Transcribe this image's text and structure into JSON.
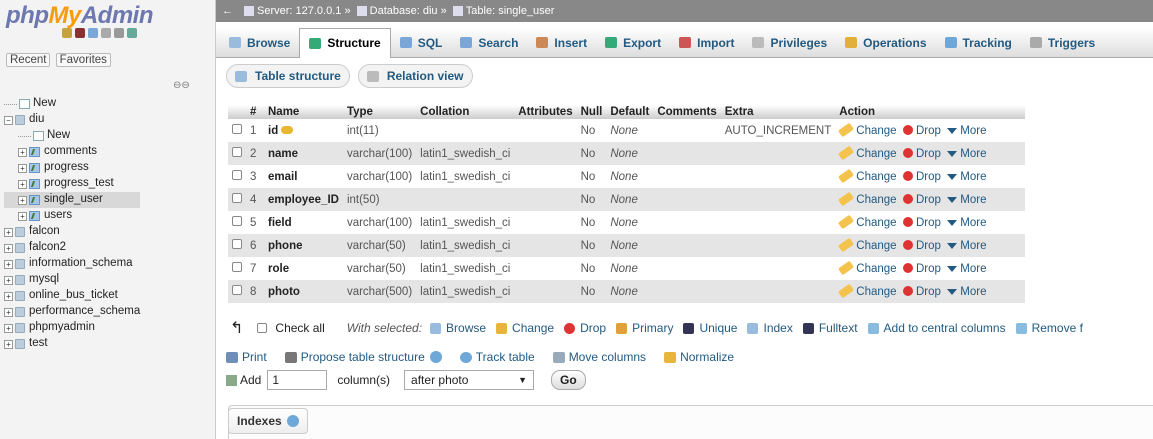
{
  "logo": {
    "php": "php",
    "my": "My",
    "admin": "Admin"
  },
  "left_tabs": [
    "Recent",
    "Favorites"
  ],
  "tree": [
    {
      "label": "New",
      "level": 0,
      "type": "new"
    },
    {
      "label": "diu",
      "level": 0,
      "type": "db",
      "expanded": true
    },
    {
      "label": "New",
      "level": 1,
      "type": "new"
    },
    {
      "label": "comments",
      "level": 1,
      "type": "table"
    },
    {
      "label": "progress",
      "level": 1,
      "type": "table"
    },
    {
      "label": "progress_test",
      "level": 1,
      "type": "table"
    },
    {
      "label": "single_user",
      "level": 1,
      "type": "table",
      "selected": true
    },
    {
      "label": "users",
      "level": 1,
      "type": "table"
    },
    {
      "label": "falcon",
      "level": 0,
      "type": "db"
    },
    {
      "label": "falcon2",
      "level": 0,
      "type": "db"
    },
    {
      "label": "information_schema",
      "level": 0,
      "type": "db"
    },
    {
      "label": "mysql",
      "level": 0,
      "type": "db"
    },
    {
      "label": "online_bus_ticket",
      "level": 0,
      "type": "db"
    },
    {
      "label": "performance_schema",
      "level": 0,
      "type": "db"
    },
    {
      "label": "phpmyadmin",
      "level": 0,
      "type": "db"
    },
    {
      "label": "test",
      "level": 0,
      "type": "db"
    }
  ],
  "breadcrumb": {
    "server": "Server: 127.0.0.1",
    "sep": "»",
    "database": "Database: diu",
    "table": "Table: single_user"
  },
  "tabs": [
    "Browse",
    "Structure",
    "SQL",
    "Search",
    "Insert",
    "Export",
    "Import",
    "Privileges",
    "Operations",
    "Tracking",
    "Triggers"
  ],
  "active_tab": "Structure",
  "subtabs": [
    "Table structure",
    "Relation view"
  ],
  "columns": [
    "#",
    "Name",
    "Type",
    "Collation",
    "Attributes",
    "Null",
    "Default",
    "Comments",
    "Extra",
    "Action"
  ],
  "rows": [
    {
      "n": "1",
      "name": "id",
      "type": "int(11)",
      "collation": "",
      "null": "No",
      "default": "None",
      "extra": "AUTO_INCREMENT",
      "key": true
    },
    {
      "n": "2",
      "name": "name",
      "type": "varchar(100)",
      "collation": "latin1_swedish_ci",
      "null": "No",
      "default": "None",
      "extra": ""
    },
    {
      "n": "3",
      "name": "email",
      "type": "varchar(100)",
      "collation": "latin1_swedish_ci",
      "null": "No",
      "default": "None",
      "extra": ""
    },
    {
      "n": "4",
      "name": "employee_ID",
      "type": "int(50)",
      "collation": "",
      "null": "No",
      "default": "None",
      "extra": ""
    },
    {
      "n": "5",
      "name": "field",
      "type": "varchar(100)",
      "collation": "latin1_swedish_ci",
      "null": "No",
      "default": "None",
      "extra": ""
    },
    {
      "n": "6",
      "name": "phone",
      "type": "varchar(50)",
      "collation": "latin1_swedish_ci",
      "null": "No",
      "default": "None",
      "extra": ""
    },
    {
      "n": "7",
      "name": "role",
      "type": "varchar(50)",
      "collation": "latin1_swedish_ci",
      "null": "No",
      "default": "None",
      "extra": ""
    },
    {
      "n": "8",
      "name": "photo",
      "type": "varchar(500)",
      "collation": "latin1_swedish_ci",
      "null": "No",
      "default": "None",
      "extra": ""
    }
  ],
  "row_actions": {
    "change": "Change",
    "drop": "Drop",
    "more": "More"
  },
  "bulk": {
    "check_all": "Check all",
    "with_selected": "With selected:",
    "actions": [
      "Browse",
      "Change",
      "Drop",
      "Primary",
      "Unique",
      "Index",
      "Fulltext",
      "Add to central columns",
      "Remove f"
    ]
  },
  "ops": {
    "print": "Print",
    "propose": "Propose table structure",
    "track": "Track table",
    "move": "Move columns",
    "normalize": "Normalize"
  },
  "add": {
    "label": "Add",
    "value": "1",
    "unit": "column(s)",
    "position": "after photo",
    "go": "Go"
  },
  "indexes": {
    "label": "Indexes"
  }
}
